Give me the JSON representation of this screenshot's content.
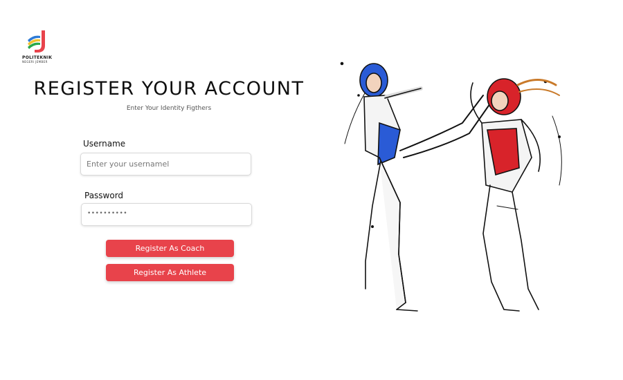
{
  "logo": {
    "line1": "POLITEKNIK",
    "line2": "NEGERI JEMBER",
    "colors": [
      "#e8434b",
      "#2e7bd6",
      "#f2c230",
      "#2aa84a"
    ]
  },
  "header": {
    "title": "REGISTER YOUR ACCOUNT",
    "subtitle": "Enter Your Identity Figthers"
  },
  "form": {
    "username": {
      "label": "Username",
      "placeholder": "Enter your usernamel"
    },
    "password": {
      "label": "Password",
      "value": "••••••••••"
    }
  },
  "actions": {
    "coach_label": "Register As Coach",
    "athlete_label": "Register As Athlete"
  },
  "colors": {
    "accent": "#e8434b",
    "fighter_blue": "#2a5bd6",
    "fighter_red": "#d8232a"
  },
  "illustration": {
    "icon": "taekwondo-fighters-illustration"
  }
}
